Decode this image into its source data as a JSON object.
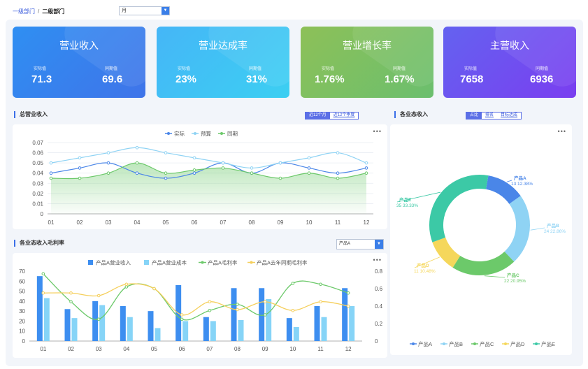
{
  "breadcrumb": {
    "level1": "一级部门",
    "separator": "/",
    "level2": "二级部门"
  },
  "period_select": {
    "value": "月"
  },
  "kpis": [
    {
      "title": "营业收入",
      "actual_label": "实际值",
      "actual": "71.3",
      "yoy_label": "同期值",
      "yoy": "69.6"
    },
    {
      "title": "营业达成率",
      "actual_label": "实际值",
      "actual": "23%",
      "yoy_label": "同期值",
      "yoy": "31%"
    },
    {
      "title": "营业增长率",
      "actual_label": "实际值",
      "actual": "1.76%",
      "yoy_label": "同期值",
      "yoy": "1.67%"
    },
    {
      "title": "主营收入",
      "actual_label": "实际值",
      "actual": "7658",
      "yoy_label": "同期值",
      "yoy": "6936"
    }
  ],
  "total_revenue": {
    "title": "总营业收入",
    "tabs": [
      "近12个月",
      "近12个季度"
    ],
    "active_tab": 0,
    "more": "•••"
  },
  "format_revenue": {
    "title": "各业态收入",
    "tabs": [
      "占比",
      "排名",
      "目标达成"
    ],
    "active_tab": 0,
    "more": "•••"
  },
  "margin_section": {
    "title": "各业态收入毛利率",
    "product_select": "产品A",
    "more": "•••"
  },
  "colors": {
    "actual": "#4a86e8",
    "budget": "#8fd3f4",
    "same": "#6cc96a",
    "bar1": "#3d8ef0",
    "bar2": "#86d4f7",
    "margin": "#6cc96a",
    "lastyear": "#f5cf5b",
    "productE": "#3cc9a6"
  },
  "chart_data": [
    {
      "type": "line",
      "legend": [
        "实际",
        "预算",
        "同期"
      ],
      "categories": [
        "01",
        "02",
        "03",
        "04",
        "05",
        "06",
        "07",
        "08",
        "09",
        "10",
        "11",
        "12"
      ],
      "ylim": [
        0,
        0.07
      ],
      "yticks": [
        "0",
        "0.01",
        "0.02",
        "0.03",
        "0.04",
        "0.05",
        "0.06",
        "0.07"
      ],
      "series": [
        {
          "name": "实际",
          "values": [
            0.04,
            0.045,
            0.05,
            0.04,
            0.035,
            0.04,
            0.05,
            0.04,
            0.05,
            0.045,
            0.04,
            0.045
          ]
        },
        {
          "name": "预算",
          "values": [
            0.05,
            0.055,
            0.06,
            0.065,
            0.06,
            0.055,
            0.05,
            0.045,
            0.05,
            0.055,
            0.06,
            0.05
          ]
        },
        {
          "name": "同期",
          "values": [
            0.035,
            0.035,
            0.04,
            0.05,
            0.04,
            0.043,
            0.045,
            0.04,
            0.035,
            0.04,
            0.035,
            0.04
          ]
        }
      ]
    },
    {
      "type": "bar",
      "legend": [
        "产品A营业收入",
        "产品A营业成本",
        "产品A毛利率",
        "产品A去年同期毛利率"
      ],
      "categories": [
        "01",
        "02",
        "03",
        "04",
        "05",
        "06",
        "07",
        "08",
        "09",
        "10",
        "11",
        "12"
      ],
      "ylim": [
        0,
        70
      ],
      "yticks": [
        "0",
        "10",
        "20",
        "30",
        "40",
        "50",
        "60",
        "70"
      ],
      "y2lim": [
        0,
        0.8
      ],
      "y2ticks": [
        "0",
        "0.2",
        "0.4",
        "0.6",
        "0.8"
      ],
      "series": [
        {
          "name": "产品A营业收入",
          "values": [
            65,
            32,
            40,
            35,
            30,
            56,
            24,
            53,
            53,
            23,
            35,
            53
          ]
        },
        {
          "name": "产品A营业成本",
          "values": [
            43,
            23,
            36,
            24,
            13,
            20,
            20,
            21,
            42,
            14,
            24,
            35
          ]
        },
        {
          "name": "产品A毛利率",
          "values": [
            0.77,
            0.45,
            0.25,
            0.62,
            0.6,
            0.25,
            0.35,
            0.42,
            0.3,
            0.66,
            0.65,
            0.55
          ]
        },
        {
          "name": "产品A去年同期毛利率",
          "values": [
            0.55,
            0.55,
            0.52,
            0.65,
            0.6,
            0.3,
            0.45,
            0.36,
            0.45,
            0.35,
            0.45,
            0.4
          ]
        }
      ]
    },
    {
      "type": "pie",
      "legend": [
        "产品A",
        "产品B",
        "产品C",
        "产品D",
        "产品E"
      ],
      "slices": [
        {
          "name": "产品A",
          "value": 13,
          "percent": "12.38%"
        },
        {
          "name": "产品B",
          "value": 24,
          "percent": "22.86%"
        },
        {
          "name": "产品C",
          "value": 22,
          "percent": "20.95%"
        },
        {
          "name": "产品D",
          "value": 11,
          "percent": "10.48%"
        },
        {
          "name": "产品E",
          "value": 35,
          "percent": "33.33%"
        }
      ],
      "slice_colors": [
        "#4a86e8",
        "#8fd3f4",
        "#6cc96a",
        "#f5d75b",
        "#3cc9a6"
      ]
    }
  ]
}
